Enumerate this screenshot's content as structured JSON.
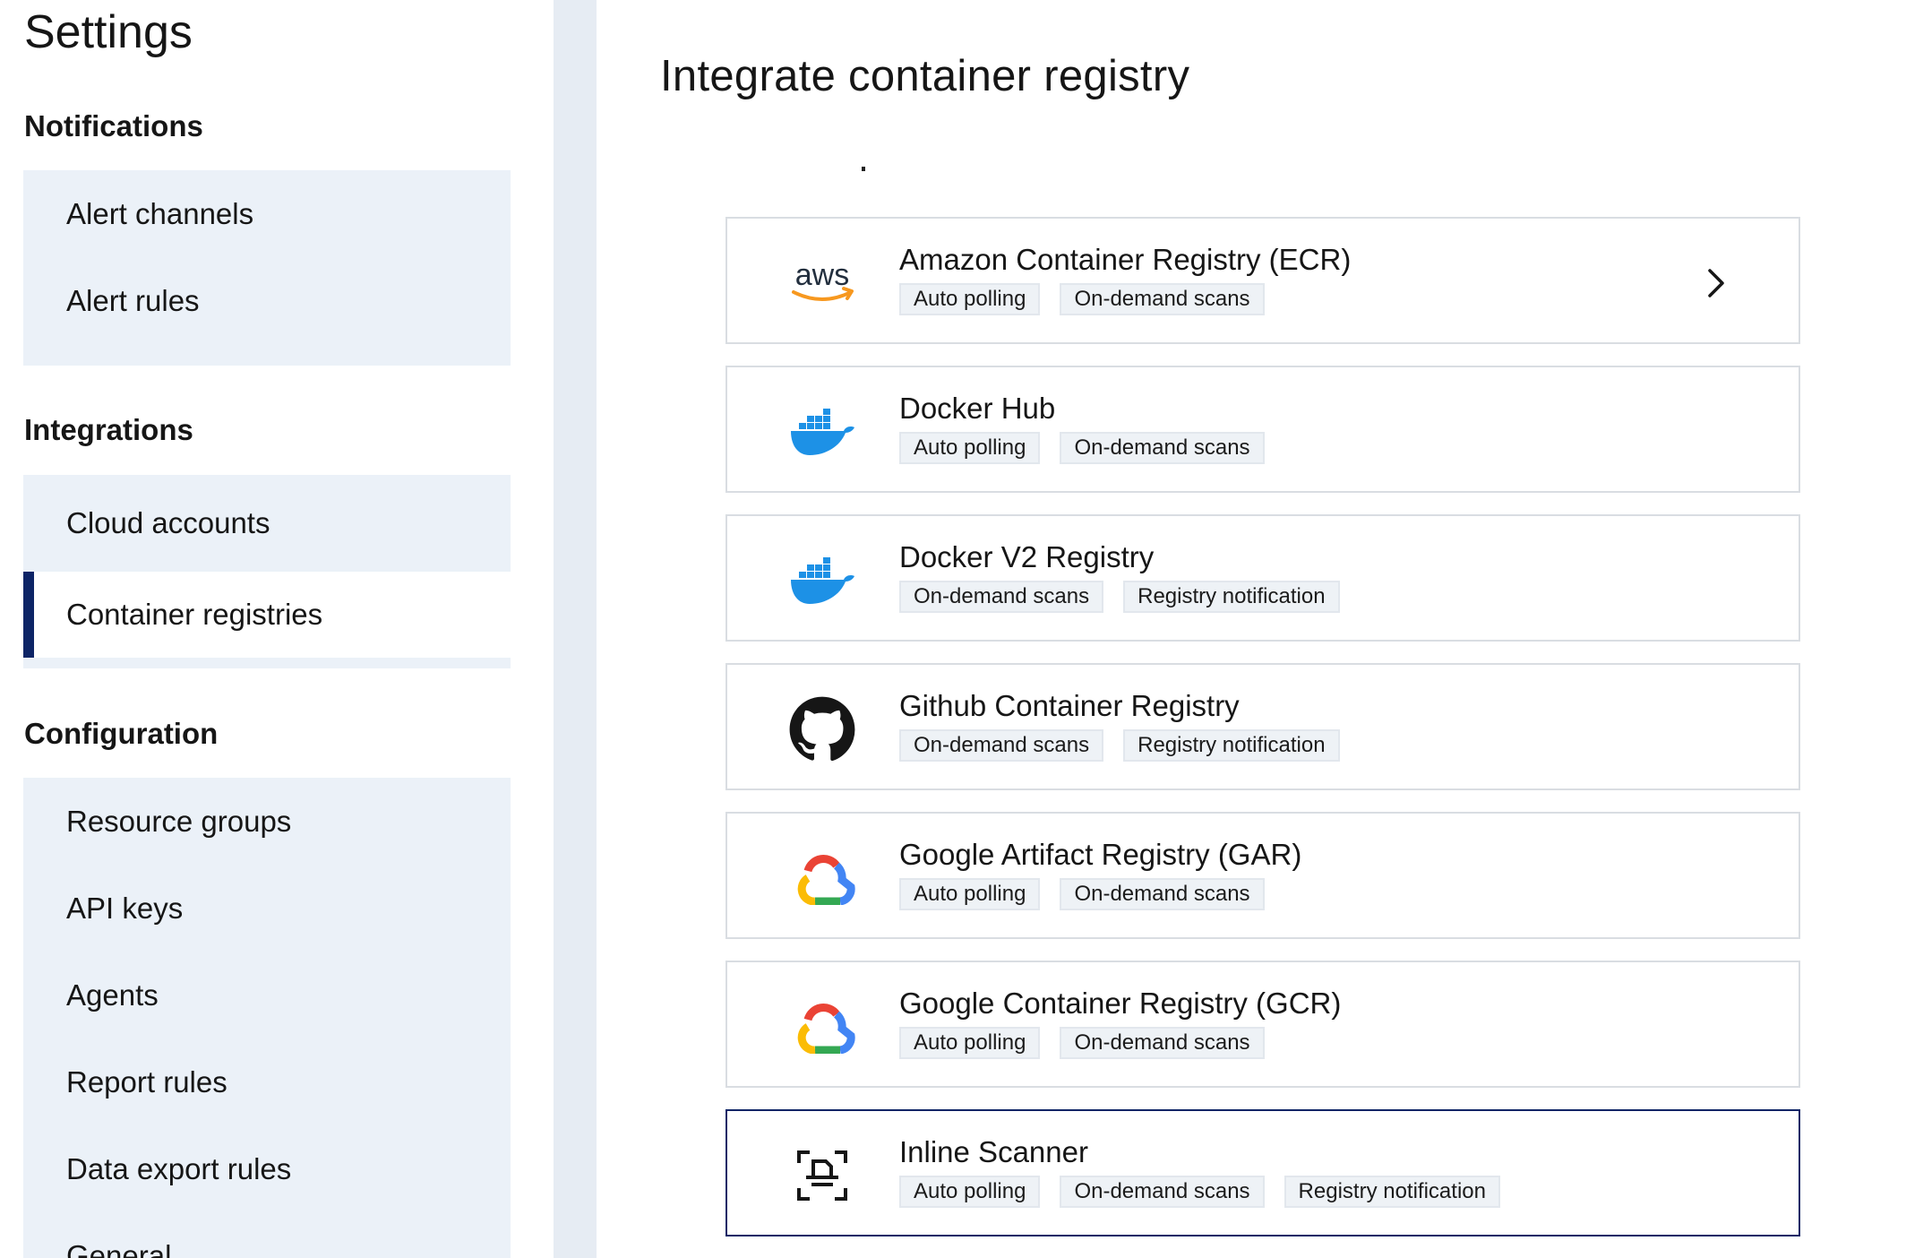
{
  "sidebar": {
    "title": "Settings",
    "sections": [
      {
        "heading": "Notifications",
        "items": [
          {
            "label": "Alert channels"
          },
          {
            "label": "Alert rules"
          }
        ]
      },
      {
        "heading": "Integrations",
        "items": [
          {
            "label": "Cloud accounts"
          },
          {
            "label": "Container registries",
            "active": true
          }
        ]
      },
      {
        "heading": "Configuration",
        "items": [
          {
            "label": "Resource groups"
          },
          {
            "label": "API keys"
          },
          {
            "label": "Agents"
          },
          {
            "label": "Report rules"
          },
          {
            "label": "Data export rules"
          },
          {
            "label": "General"
          }
        ]
      }
    ]
  },
  "main": {
    "title": "Integrate container registry",
    "registries": [
      {
        "name": "Amazon Container Registry (ECR)",
        "icon": "aws-logo-icon",
        "tags": [
          "Auto polling",
          "On-demand scans"
        ],
        "chevron": true
      },
      {
        "name": "Docker Hub",
        "icon": "docker-logo-icon",
        "tags": [
          "Auto polling",
          "On-demand scans"
        ]
      },
      {
        "name": "Docker V2 Registry",
        "icon": "docker-logo-icon",
        "tags": [
          "On-demand scans",
          "Registry notification"
        ]
      },
      {
        "name": "Github Container Registry",
        "icon": "github-logo-icon",
        "tags": [
          "On-demand scans",
          "Registry notification"
        ]
      },
      {
        "name": "Google Artifact Registry (GAR)",
        "icon": "google-cloud-logo-icon",
        "tags": [
          "Auto polling",
          "On-demand scans"
        ]
      },
      {
        "name": "Google Container Registry (GCR)",
        "icon": "google-cloud-logo-icon",
        "tags": [
          "Auto polling",
          "On-demand scans"
        ]
      },
      {
        "name": "Inline Scanner",
        "icon": "inline-scanner-icon",
        "tags": [
          "Auto polling",
          "On-demand scans",
          "Registry notification"
        ],
        "selected": true
      }
    ]
  },
  "colors": {
    "sidebar_group_bg": "#ebf1f8",
    "active_accent": "#0d2466",
    "card_border": "#d9dde2",
    "docker_blue": "#1d91e6",
    "aws_orange": "#f7981f"
  }
}
